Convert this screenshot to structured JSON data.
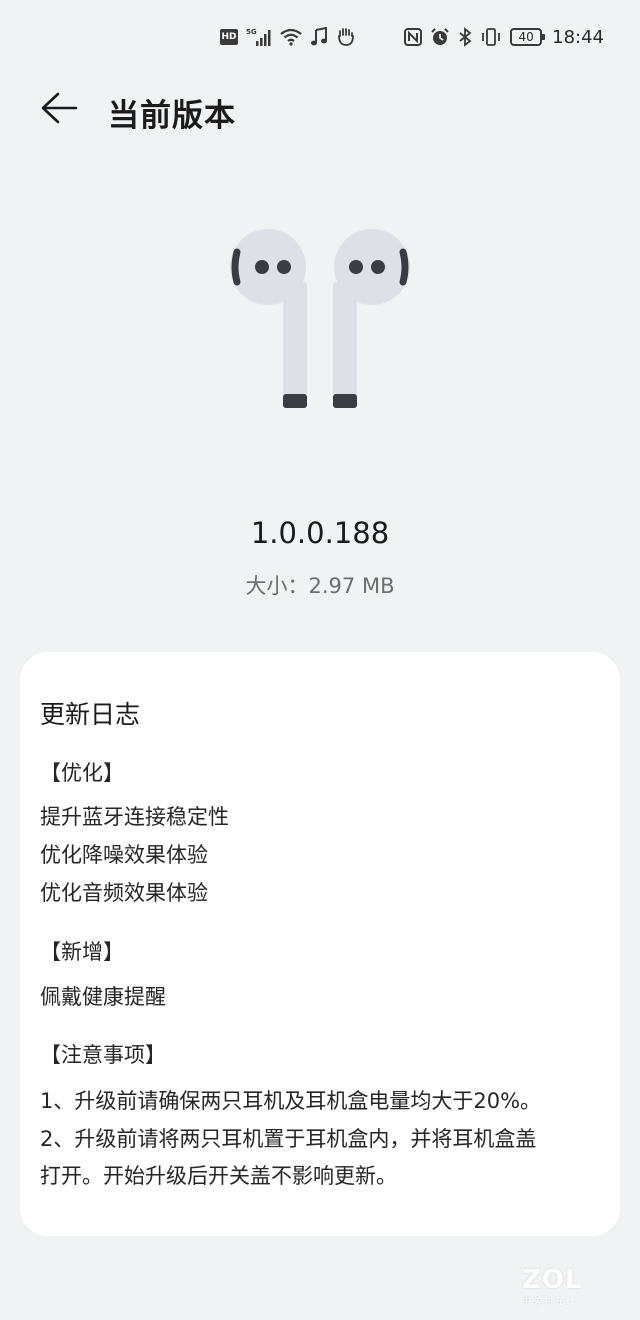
{
  "status_bar": {
    "left_icons": [
      "hd-icon",
      "5g-signal-icon",
      "wifi-icon",
      "music-note-icon",
      "hand-icon"
    ],
    "right_icons": [
      "nfc-icon",
      "alarm-icon",
      "bluetooth-icon",
      "vibrate-icon"
    ],
    "hd_label": "HD",
    "network_label": "5G",
    "battery": "40",
    "time": "18:44"
  },
  "header": {
    "back_icon": "arrow-left-icon",
    "title": "当前版本"
  },
  "product": {
    "image": "earbuds-icon",
    "version": "1.0.0.188",
    "size_text": "大小：2.97 MB"
  },
  "changelog": {
    "title": "更新日志",
    "sections": [
      {
        "heading": "【优化】",
        "items": [
          "提升蓝牙连接稳定性",
          "优化降噪效果体验",
          "优化音频效果体验"
        ]
      },
      {
        "heading": "【新增】",
        "items": [
          "佩戴健康提醒"
        ]
      },
      {
        "heading": "【注意事项】",
        "items": [
          "1、升级前请确保两只耳机及耳机盒电量均大于20%。",
          "2、升级前请将两只耳机置于耳机盒内，并将耳机盒盖",
          "打开。开始升级后开关盖不影响更新。"
        ]
      }
    ]
  },
  "watermark": {
    "text": "ZOL",
    "subtext": "中关村在线"
  },
  "colors": {
    "background": "#f1f2f4",
    "card": "#ffffff",
    "text_primary": "#1b1b1b",
    "text_secondary": "#6d6d6d",
    "earbud_body": "#dfe0e6",
    "earbud_tip": "#3b3c42"
  }
}
